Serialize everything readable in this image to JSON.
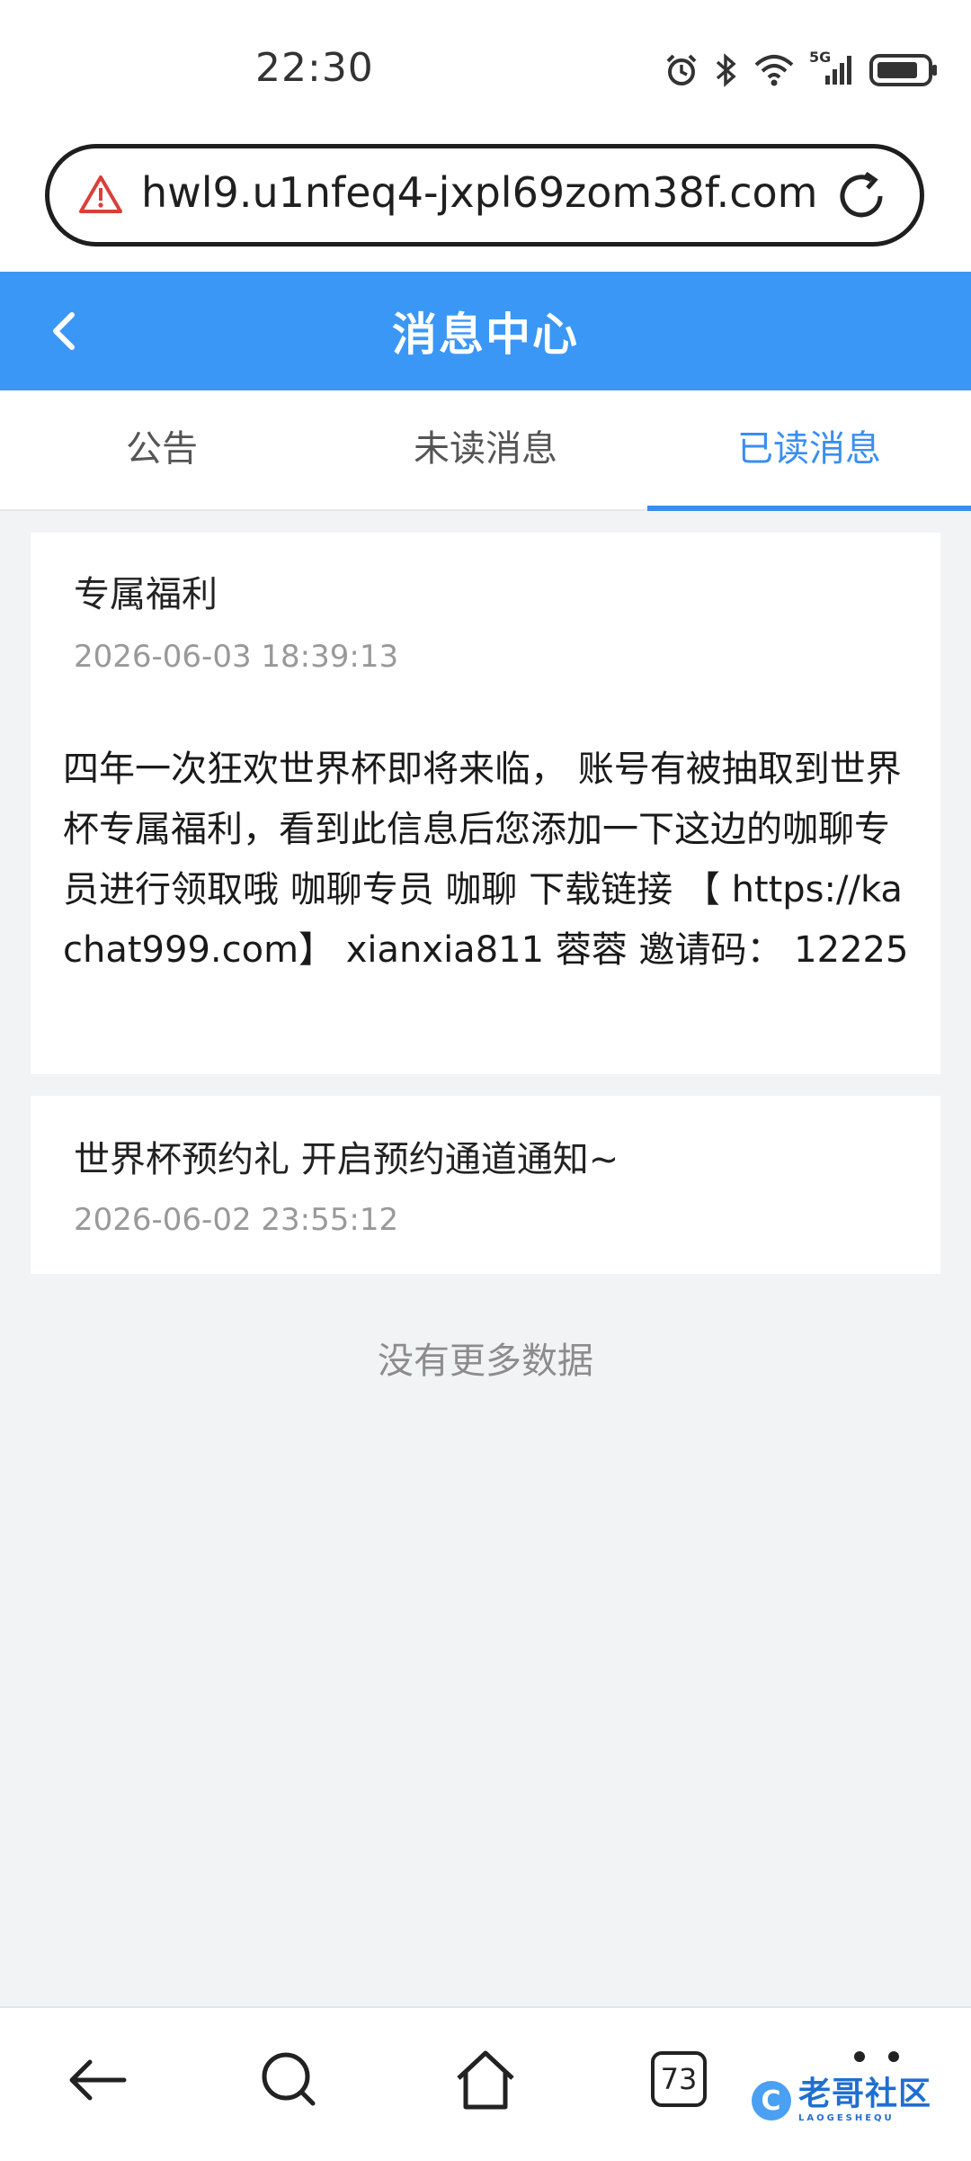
{
  "status_bar": {
    "time": "22:30",
    "icons": [
      "alarm-icon",
      "bluetooth-icon",
      "wifi-icon",
      "5g-signal-icon",
      "battery-icon"
    ],
    "network_label": "5G"
  },
  "browser": {
    "url": "hwl9.u1nfeq4-jxpl69zom38f.com"
  },
  "header": {
    "title": "消息中心"
  },
  "tabs": [
    {
      "label": "公告"
    },
    {
      "label": "未读消息"
    },
    {
      "label": "已读消息"
    }
  ],
  "messages": [
    {
      "title": "专属福利",
      "date": "2026-06-03 18:39:13",
      "body": "四年一次狂欢世界杯即将来临， 账号有被抽取到世界杯专属福利，看到此信息后您添加一下这边的咖聊专员进行领取哦 咖聊专员 咖聊 下载链接 【 https://kachat999.com】 xianxia811 蓉蓉 邀请码： 12225"
    },
    {
      "title": "世界杯预约礼 开启预约通道通知~",
      "date": "2026-06-02 23:55:12"
    }
  ],
  "list_footer": "没有更多数据",
  "bottom_nav": {
    "tab_count": "73"
  },
  "watermark": {
    "text": "老哥社区",
    "sub": "LAOGESHEQU"
  },
  "colors": {
    "header_bg": "#3a97f5",
    "active_tab": "#3a8ef0",
    "page_bg": "#f2f3f5"
  }
}
